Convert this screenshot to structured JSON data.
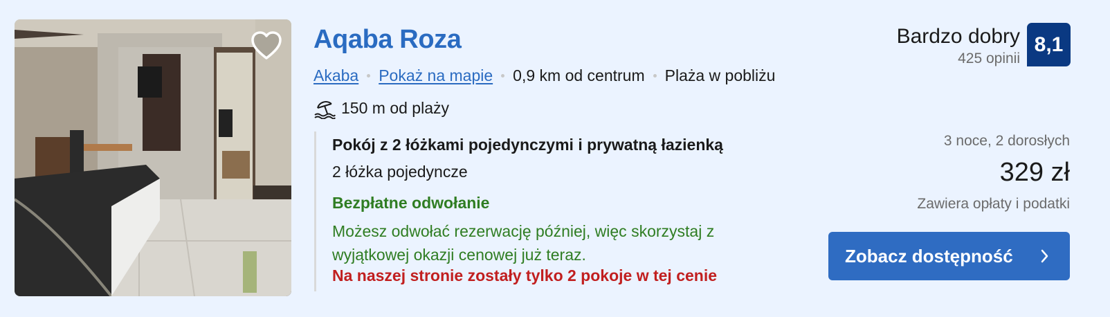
{
  "hotel": {
    "name": "Aqaba Roza",
    "city_link": "Akaba",
    "map_link": "Pokaż na mapie",
    "distance": "0,9 km od centrum",
    "beach_nearby": "Plaża w pobliżu",
    "beach_distance": "150 m od plaży"
  },
  "room": {
    "title": "Pokój z 2 łóżkami pojedynczymi i prywatną łazienką",
    "beds": "2 łóżka pojedyncze",
    "cancellation_title": "Bezpłatne odwołanie",
    "cancellation_desc": "Możesz odwołać rezerwację później, więc skorzystaj z wyjątkowej okazji cenowej już teraz.",
    "scarcity": "Na naszej stronie zostały tylko 2 pokoje w tej cenie"
  },
  "review": {
    "score_word": "Bardzo dobry",
    "review_count": "425 opinii",
    "score": "8,1"
  },
  "pricing": {
    "stay": "3 noce, 2 dorosłych",
    "price": "329 zł",
    "taxes": "Zawiera opłaty i podatki"
  },
  "cta": {
    "label": "Zobacz dostępność"
  },
  "icons": {
    "favorite": "heart-outline-icon",
    "beach": "beach-umbrella-icon",
    "cta": "chevron-right-icon"
  },
  "colors": {
    "background": "#ebf3ff",
    "link": "#2a6bc1",
    "score_badge": "#0a3982",
    "cta": "#2f6cc2",
    "green": "#2f7d22",
    "red": "#c11f1f"
  }
}
